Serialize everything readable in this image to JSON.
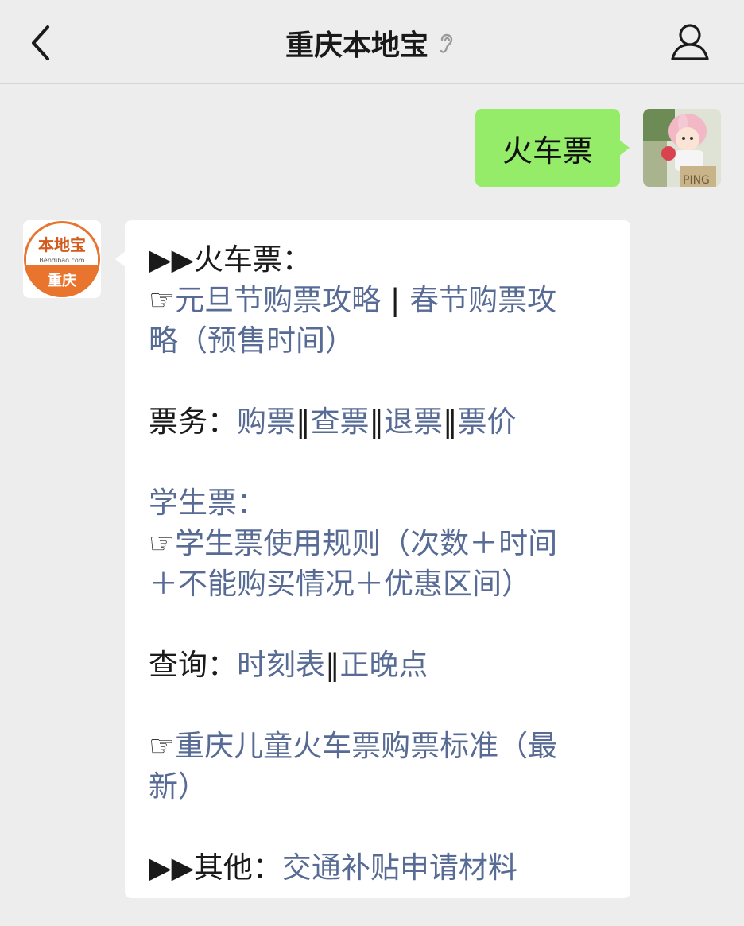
{
  "header": {
    "title": "重庆本地宝",
    "back_icon": "chevron-left-icon",
    "ear_icon": "ear-icon",
    "profile_icon": "person-icon"
  },
  "user_message": {
    "text": "火车票",
    "bubble_color": "#95ec69",
    "avatar_label": "PING"
  },
  "bot": {
    "logo_text_top": "本地宝",
    "logo_url_text": "Bendibao.com",
    "logo_text_bottom": "重庆",
    "logo_color": "#e8742e"
  },
  "bot_message": {
    "link_color": "#576b95",
    "arrows": "▶▶",
    "pointer": "☞",
    "s1_title": "火车票：",
    "s1_link1": "元旦节购票攻略",
    "s1_sep": " | ",
    "s1_link2_a": "春节购票攻",
    "s1_link2_b": "略（预售时间）",
    "s2_label": "票务：",
    "s2_links": [
      "购票",
      "查票",
      "退票",
      "票价"
    ],
    "s2_sep": "‖",
    "s3_title": "学生票：",
    "s3_link_a": "学生票使用规则（次数＋时间",
    "s3_link_b": "＋不能购买情况＋优惠区间）",
    "s4_label": "查询：",
    "s4_links": [
      "时刻表",
      "正晚点"
    ],
    "s5_link_a": "重庆儿童火车票购票标准（最",
    "s5_link_b": "新）",
    "s6_label": "其他：",
    "s6_link": "交通补贴申请材料"
  }
}
